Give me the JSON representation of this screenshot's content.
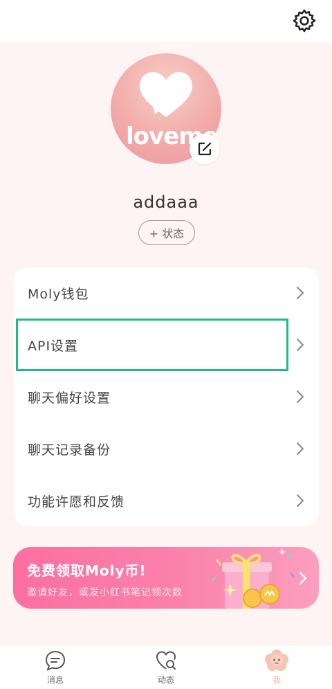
{
  "header": {
    "settings_icon": "gear-icon"
  },
  "profile": {
    "avatar_text": "loveme",
    "edit_icon": "edit-icon",
    "username": "addaaa",
    "status_button": "+ 状态"
  },
  "menu": {
    "items": [
      {
        "label": "Moly钱包"
      },
      {
        "label": "API设置"
      },
      {
        "label": "聊天偏好设置"
      },
      {
        "label": "聊天记录备份"
      },
      {
        "label": "功能许愿和反馈"
      }
    ],
    "highlight_color": "#1fbb82"
  },
  "banner": {
    "title": "免费领取Moly币!",
    "subtitle": "邀请好友，或发小红书笔记领次数",
    "colors": {
      "start": "#fb6fa0",
      "end": "#fc9fbf"
    }
  },
  "tabbar": {
    "tabs": [
      {
        "label": "消息",
        "icon": "chat-bubble-icon"
      },
      {
        "label": "动态",
        "icon": "heart-search-icon"
      },
      {
        "label": "我",
        "icon": "flower-face-icon",
        "active": true
      }
    ]
  },
  "colors": {
    "background": "#fdf4f3",
    "accent_pink": "#fa82ab",
    "active_tab": "#f0b7a6"
  }
}
